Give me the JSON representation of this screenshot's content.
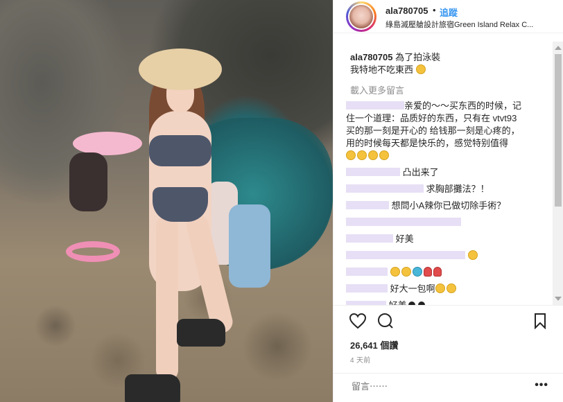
{
  "post": {
    "username": "ala780705",
    "follow_label": "追蹤",
    "separator": "•",
    "location": "綠島滅壓艙設計旅宿Green Island Relax C...",
    "caption_user": "ala780705",
    "caption_line1": "為了拍泳裝",
    "caption_line2": "我特地不吃東西",
    "load_more": "載入更多留言",
    "likes": "26,641 個讚",
    "time": "4 天前",
    "comment_placeholder": "留言⋯⋯",
    "more_label": "•••"
  },
  "comments": [
    {
      "text_a": "亲爱的～～买东西的时候，记",
      "text_b": "住一个道理：品质好的东西，只有在 vtvt93",
      "text_c": "买的那一刻是开心的 给钱那一刻是心疼的，",
      "text_d": "用的时候每天都是快乐的，感觉特别值得"
    },
    {
      "text": "凸出来了"
    },
    {
      "text": "求胸部攤法？！"
    },
    {
      "text": "想問小A辣你已做切除手術？"
    },
    {
      "text": ""
    },
    {
      "text": "好美"
    },
    {
      "text": ""
    },
    {
      "text": ""
    },
    {
      "text": "好大一包啊"
    },
    {
      "text": "好美"
    }
  ],
  "icons": {
    "like": "heart-outline",
    "comment": "speech-bubble",
    "save": "bookmark"
  },
  "colors": {
    "link_blue": "#3897f0",
    "muted": "#8e8e8e",
    "redaction": "#e7dff5"
  }
}
